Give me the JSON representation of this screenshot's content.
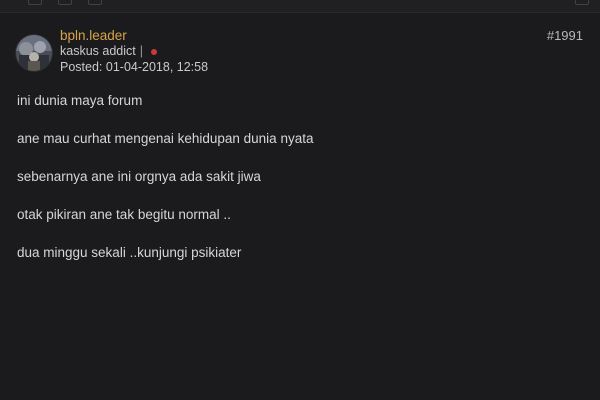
{
  "post": {
    "author": {
      "username": "bpln.leader",
      "rank": "kaskus addict",
      "rank_separator": "|",
      "posted_label": "Posted:",
      "posted_at": "01-04-2018, 12:58",
      "status_color": "#c73a3a",
      "username_color": "#d7a44a"
    },
    "number": "#1991",
    "lines": [
      "ini dunia maya forum",
      "ane mau curhat mengenai kehidupan dunia nyata",
      "sebenarnya ane ini orgnya ada sakit jiwa",
      "otak pikiran ane tak begitu normal ..",
      "dua minggu sekali ..kunjungi psikiater"
    ]
  }
}
